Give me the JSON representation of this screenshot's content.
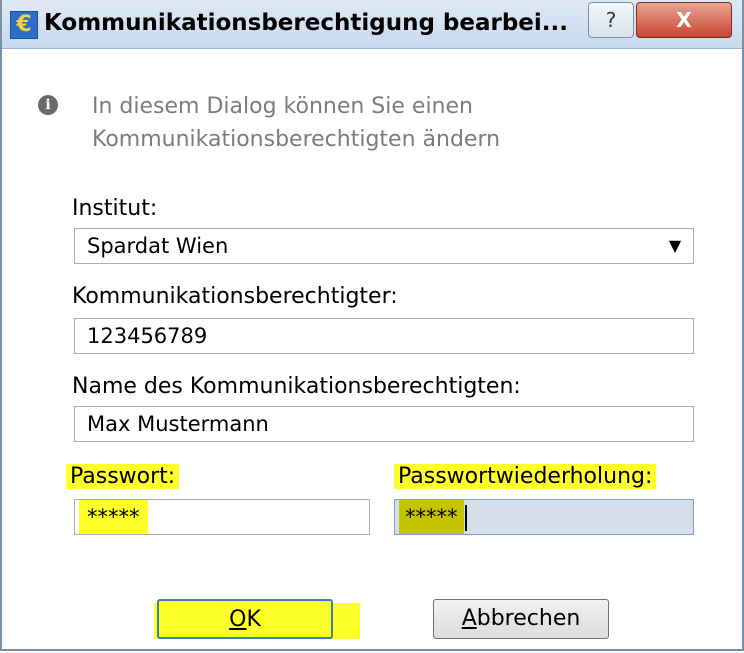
{
  "window": {
    "app_icon_glyph": "€",
    "title": "Kommunikationsberechtigung bearbei...",
    "help_glyph": "?",
    "close_glyph": "X"
  },
  "info": {
    "icon": "info-icon",
    "text": "In diesem Dialog können Sie einen Kommunikationsberechtigten ändern"
  },
  "form": {
    "institut_label": "Institut:",
    "institut_value": "Spardat Wien",
    "dropdown_arrow": "▼",
    "berechtigter_label": "Kommunikationsberechtigter:",
    "berechtigter_value": "123456789",
    "name_label": "Name des Kommunikationsberechtigten:",
    "name_value": "Max Mustermann",
    "passwort_label": "Passwort:",
    "passwort_value": "*****",
    "wiederholung_label": "Passwortwiederholung:",
    "wiederholung_value": "*****"
  },
  "buttons": {
    "ok_mnemonic": "O",
    "ok_rest": "K",
    "cancel_mnemonic": "A",
    "cancel_rest": "bbrechen"
  },
  "colors": {
    "highlight": "#ffff2a",
    "focused_field": "#d4dfe9"
  }
}
